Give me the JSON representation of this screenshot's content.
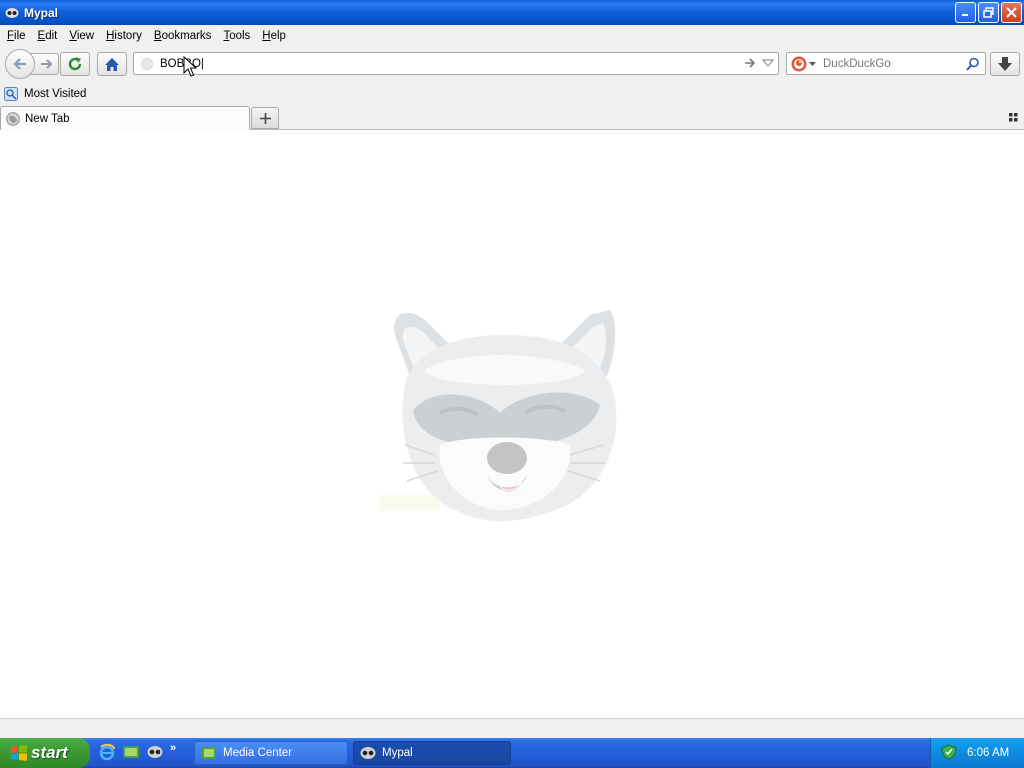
{
  "window": {
    "title": "Mypal"
  },
  "menu": [
    {
      "accel": "F",
      "rest": "ile"
    },
    {
      "accel": "E",
      "rest": "dit"
    },
    {
      "accel": "V",
      "rest": "iew"
    },
    {
      "accel": "H",
      "rest": "istory"
    },
    {
      "accel": "B",
      "rest": "ookmarks"
    },
    {
      "accel": "T",
      "rest": "ools"
    },
    {
      "accel": "H",
      "rest": "elp"
    }
  ],
  "urlbar": {
    "value": "BOBBO|"
  },
  "search": {
    "placeholder": "DuckDuckGo",
    "engine_icon": "duckduckgo-icon"
  },
  "bookmarks": [
    {
      "label": "Most Visited",
      "icon": "bookmark-folder-icon"
    }
  ],
  "tabs": [
    {
      "label": "New Tab",
      "icon": "globe-icon"
    }
  ],
  "content": {
    "logo": "raccoon-head-image"
  },
  "taskbar": {
    "start_label": "start",
    "items": [
      {
        "label": "Media Center",
        "active": false
      },
      {
        "label": "Mypal",
        "active": true
      }
    ],
    "clock": "6:06 AM"
  }
}
